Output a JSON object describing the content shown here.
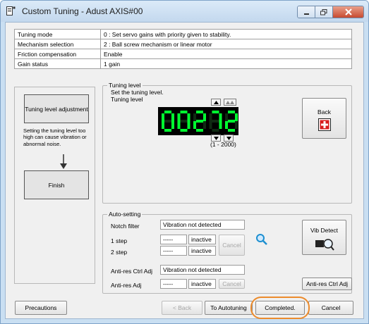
{
  "window": {
    "title": "Custom Tuning - Adust AXIS#00"
  },
  "info_table": [
    {
      "label": "Tuning mode",
      "value": "0 : Set servo gains with priority given to stability."
    },
    {
      "label": "Mechanism selection",
      "value": "2 : Ball screw mechanism or linear motor"
    },
    {
      "label": "Friction compensation",
      "value": "Enable"
    },
    {
      "label": "Gain status",
      "value": "1 gain"
    }
  ],
  "left_panel": {
    "tuning_step_label": "Tuning level adjustment",
    "warning": "Setting the tuning level too high can cause vibration or abnormal noise.",
    "finish_label": "Finish"
  },
  "tuning_level": {
    "legend": "Tuning level",
    "instruction": "Set the tuning level.",
    "label": "Tuning level",
    "value": "00272",
    "range": "(1 - 2000)",
    "back_label": "Back"
  },
  "auto_setting": {
    "legend": "Auto-setting",
    "notch_filter_label": "Notch filter",
    "notch_status": "Vibration not detected",
    "step1_label": "1 step",
    "step1_value": "-----",
    "step1_state": "inactive",
    "step2_label": "2 step",
    "step2_value": "-----",
    "step2_state": "inactive",
    "cancel_label": "Cancel",
    "vib_detect_label": "Vib Detect",
    "anti_res_ctrl_adj_label": "Anti-res Ctrl Adj",
    "anti_res_status": "Vibration not detected",
    "anti_res_adj_label": "Anti-res Adj",
    "anti_res_adj_value": "-----",
    "anti_res_adj_state": "inactive",
    "anti_res_cancel_label": "Cancel",
    "anti_res_ctrl_adj_button": "Anti-res Ctrl Adj"
  },
  "footer": {
    "precautions": "Precautions",
    "back": "< Back",
    "to_autotuning": "To Autotuning",
    "completed": "Completed.",
    "cancel": "Cancel"
  },
  "colors": {
    "segment_on": "#00ff30",
    "highlight": "#ec8b2c",
    "back_icon": "#d81e1e"
  }
}
